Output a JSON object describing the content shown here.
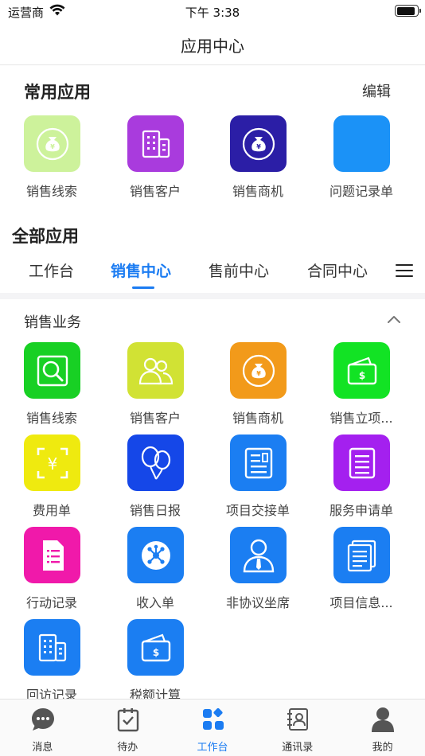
{
  "status_bar": {
    "carrier": "运营商",
    "time": "下午 3:38",
    "battery_level": 0.95
  },
  "nav": {
    "title": "应用中心"
  },
  "common_apps": {
    "title": "常用应用",
    "edit_label": "编辑",
    "items": [
      {
        "label": "销售线索",
        "icon": "money-bag-icon",
        "color": "#cdf29b"
      },
      {
        "label": "销售客户",
        "icon": "building-icon",
        "color": "#a93bdd"
      },
      {
        "label": "销售商机",
        "icon": "money-bag-icon",
        "color": "#2b1ea6"
      },
      {
        "label": "问题记录单",
        "icon": "blank-icon",
        "color": "#1b92f7"
      }
    ]
  },
  "all_apps": {
    "title": "全部应用",
    "tabs": [
      {
        "label": "工作台",
        "active": false
      },
      {
        "label": "销售中心",
        "active": true
      },
      {
        "label": "售前中心",
        "active": false
      },
      {
        "label": "合同中心",
        "active": false
      }
    ],
    "menu_icon": "menu-icon",
    "group": {
      "title": "销售业务",
      "collapse_icon": "chevron-up-icon",
      "items": [
        {
          "label": "销售线索",
          "icon": "search-icon",
          "color": "#18d024"
        },
        {
          "label": "销售客户",
          "icon": "customers-icon",
          "color": "#d1e234"
        },
        {
          "label": "销售商机",
          "icon": "money-bag-icon",
          "color": "#f29a1a"
        },
        {
          "label": "销售立项...",
          "icon": "wallet-icon",
          "color": "#12e324"
        },
        {
          "label": "费用单",
          "icon": "yuan-scan-icon",
          "color": "#efea0f"
        },
        {
          "label": "销售日报",
          "icon": "balloon-icon",
          "color": "#1547e8"
        },
        {
          "label": "项目交接单",
          "icon": "newspaper-icon",
          "color": "#1b7ef2"
        },
        {
          "label": "服务申请单",
          "icon": "document-icon",
          "color": "#a420ef"
        },
        {
          "label": "行动记录",
          "icon": "list-doc-icon",
          "color": "#f019aa"
        },
        {
          "label": "收入单",
          "icon": "network-icon",
          "color": "#1b7ef2"
        },
        {
          "label": "非协议坐席",
          "icon": "person-icon",
          "color": "#1b7ef2"
        },
        {
          "label": "项目信息...",
          "icon": "papers-icon",
          "color": "#1b7ef2"
        },
        {
          "label": "回访记录",
          "icon": "building-icon",
          "color": "#1b7ef2"
        },
        {
          "label": "税额计算",
          "icon": "wallet-icon",
          "color": "#1b7ef2"
        }
      ]
    }
  },
  "tab_bar": {
    "items": [
      {
        "label": "消息",
        "icon": "chat-icon",
        "active": false
      },
      {
        "label": "待办",
        "icon": "todo-icon",
        "active": false
      },
      {
        "label": "工作台",
        "icon": "grid-icon",
        "active": true
      },
      {
        "label": "通讯录",
        "icon": "contacts-icon",
        "active": false
      },
      {
        "label": "我的",
        "icon": "profile-icon",
        "active": false
      }
    ]
  },
  "colors": {
    "accent": "#1b7cf2",
    "tab_bar_inactive": "#555555"
  }
}
